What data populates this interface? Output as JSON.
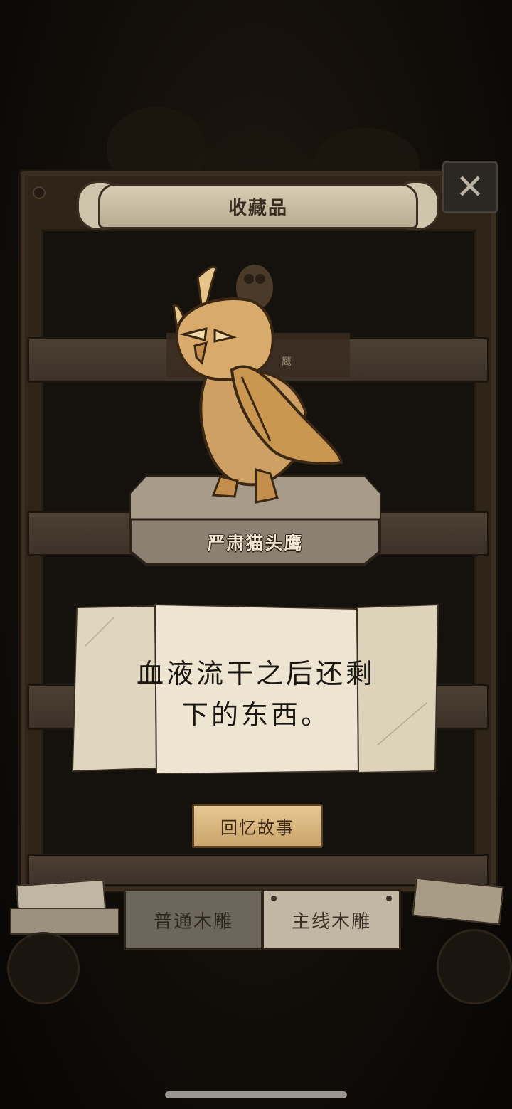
{
  "header": {
    "title": "收藏品",
    "close_icon": "close-icon"
  },
  "item": {
    "name": "严肃猫头鹰",
    "background_label": "鹰",
    "description": "血液流干之后还剩下的东西。",
    "description_line1": "血液流干之后还剩",
    "description_line2": "下的东西。"
  },
  "actions": {
    "recall_label": "回忆故事"
  },
  "tabs": [
    {
      "label": "普通木雕",
      "active": false
    },
    {
      "label": "主线木雕",
      "active": true
    }
  ],
  "colors": {
    "wood_dark": "#2e2418",
    "parchment": "#e3dbc7",
    "recall_button": "#d9b781",
    "owl": "#d2a35f"
  }
}
